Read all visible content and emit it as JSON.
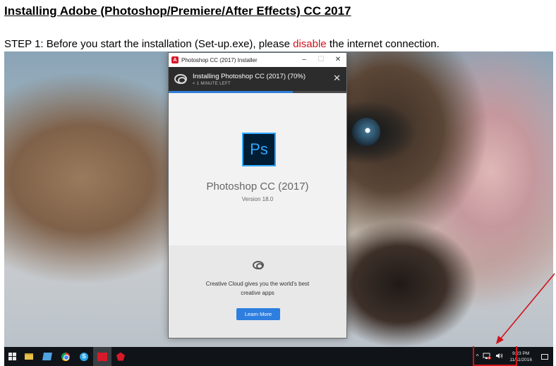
{
  "document": {
    "title": "Installing Adobe (Photoshop/Premiere/After Effects) CC 2017",
    "step_prefix": "STEP 1: Before you start the installation (Set-up.exe), please ",
    "step_highlight": "disable",
    "step_suffix": " the internet connection.",
    "highlight_color": "#d0121b"
  },
  "installer": {
    "window_title": "Photoshop CC (2017) Installer",
    "window_controls": [
      "–",
      "☐",
      "✕"
    ],
    "progress_title": "Installing Photoshop CC (2017) (70%)",
    "progress_subtitle": "< 1 MINUTE LEFT",
    "progress_percent": 70,
    "progress_close": "✕",
    "app_logo_text": "Ps",
    "product_name": "Photoshop CC (2017)",
    "version": "Version 18.0",
    "promo_text": "Creative Cloud gives you the world's best creative apps",
    "learn_more_label": "Learn More",
    "accent_color": "#2e7ee0"
  },
  "taskbar": {
    "icons": [
      "windows-start-icon",
      "file-explorer-icon",
      "edge-icon",
      "chrome-icon",
      "skype-icon",
      "adobe-cc-icon",
      "adobe-app-icon"
    ],
    "tray_chevron": "^",
    "clock_time": "9:23 PM",
    "clock_date": "11/11/2016"
  }
}
